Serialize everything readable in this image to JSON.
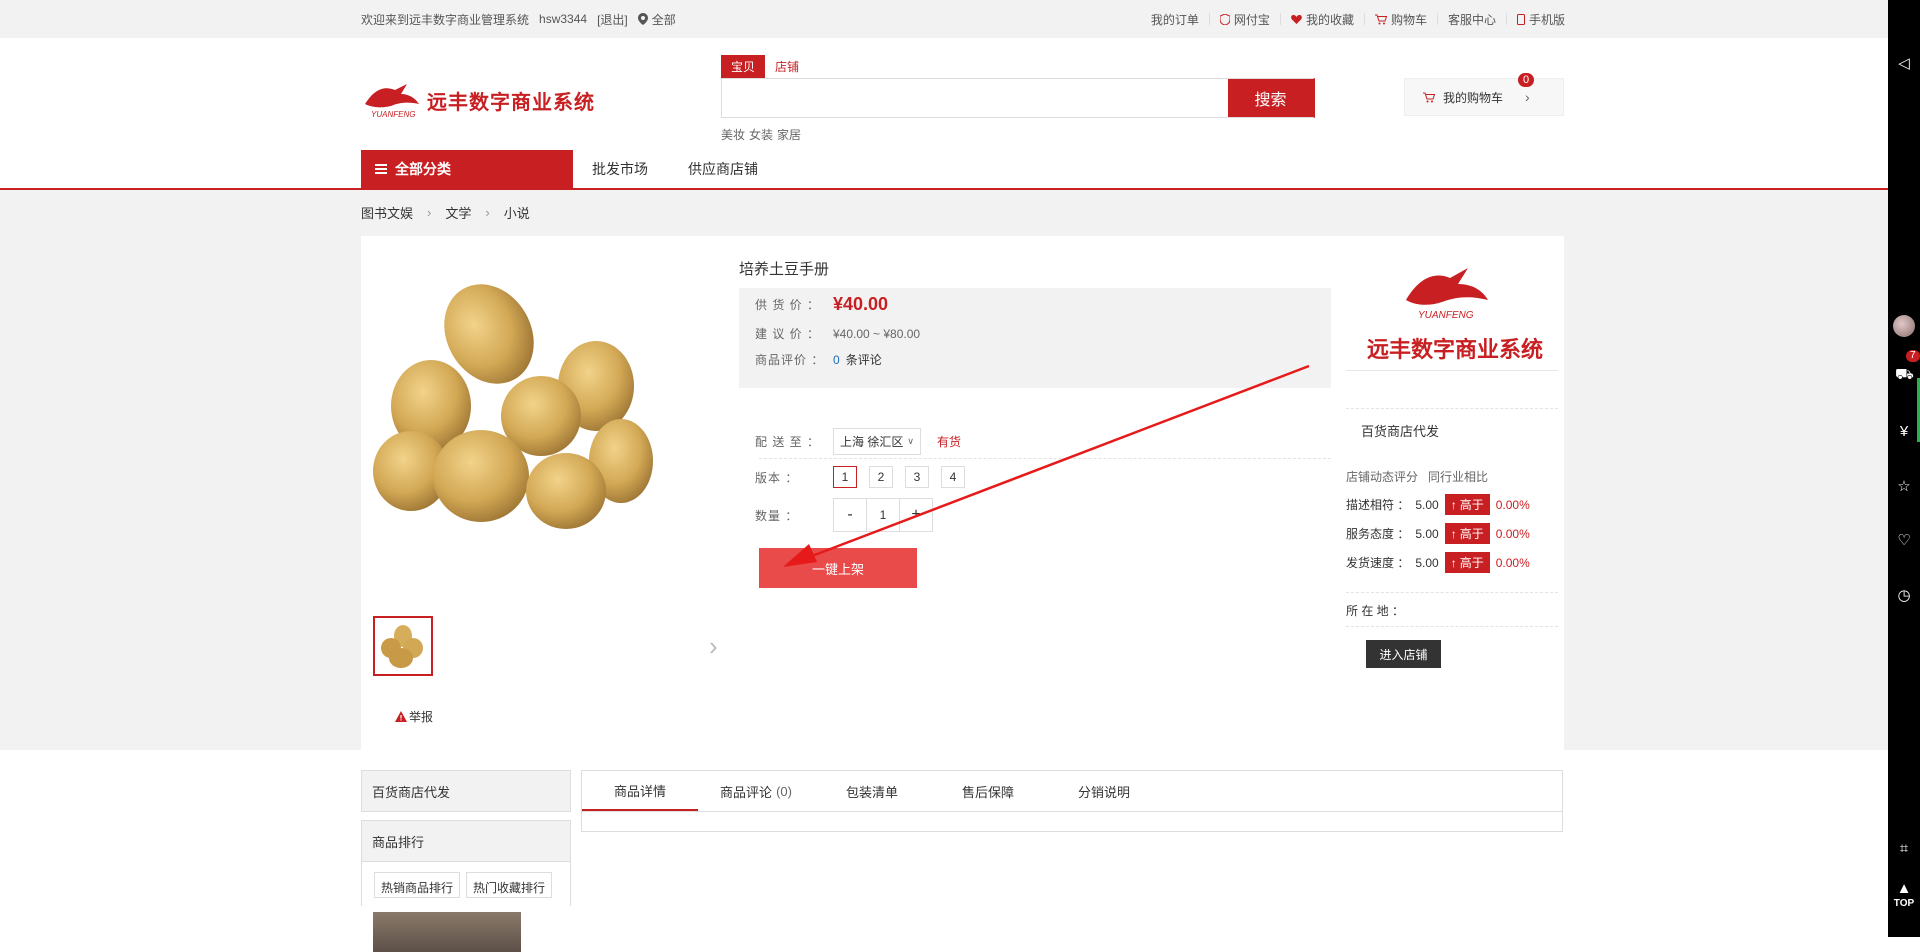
{
  "topbar": {
    "welcome": "欢迎来到远丰数字商业管理系统",
    "username": "hsw3344",
    "logout": "[退出]",
    "location": "全部",
    "links": [
      "我的订单",
      "网付宝",
      "我的收藏",
      "购物车",
      "客服中心",
      "手机版"
    ]
  },
  "header": {
    "brand": "远丰数字商业系统",
    "logo_text": "YUANFENG",
    "search_tabs": [
      "宝贝",
      "店铺"
    ],
    "search_placeholder": "",
    "search_button": "搜索",
    "hotwords": [
      "美妆",
      "女装",
      "家居"
    ],
    "cart_label": "我的购物车",
    "cart_count": "0"
  },
  "nav": {
    "all_categories": "全部分类",
    "links": [
      "批发市场",
      "供应商店铺"
    ]
  },
  "breadcrumb": [
    "图书文娱",
    "文学",
    "小说"
  ],
  "product": {
    "title": "培养土豆手册",
    "supply_price_label": "供 货 价 ：",
    "supply_price": "¥40.00",
    "suggested_price_label": "建 议 价 ：",
    "suggested_price": "¥40.00 ~ ¥80.00",
    "rating_label": "商品评价 ：",
    "rating_count": "0",
    "rating_suffix": "条评论",
    "delivery_label": "配 送 至 ：",
    "delivery_region": "上海 徐汇区",
    "stock": "有货",
    "version_label": "版本 ：",
    "versions": [
      "1",
      "2",
      "3",
      "4"
    ],
    "selected_version": "1",
    "quantity_label": "数量 ：",
    "quantity": "1",
    "minus": "-",
    "plus": "+",
    "one_key_button": "一键上架",
    "report": "举报"
  },
  "store": {
    "logo_text": "YUANFENG",
    "brand": "远丰数字商业系统",
    "name": "百货商店代发",
    "dyn_score": "店铺动态评分",
    "compare": "同行业相比",
    "scores": [
      {
        "label": "描述相符 ：",
        "value": "5.00",
        "badge": "高于",
        "pct": "0.00%"
      },
      {
        "label": "服务态度 ：",
        "value": "5.00",
        "badge": "高于",
        "pct": "0.00%"
      },
      {
        "label": "发货速度 ：",
        "value": "5.00",
        "badge": "高于",
        "pct": "0.00%"
      }
    ],
    "location_label": "所 在 地 ：",
    "enter_button": "进入店铺"
  },
  "lower": {
    "left_store": "百货商店代发",
    "ranking_title": "商品排行",
    "ranking_tabs": [
      "热销商品排行",
      "热门收藏排行"
    ],
    "tabs": [
      {
        "label": "商品详情",
        "count": ""
      },
      {
        "label": "商品评论",
        "count": "(0)"
      },
      {
        "label": "包装清单",
        "count": ""
      },
      {
        "label": "售后保障",
        "count": ""
      },
      {
        "label": "分销说明",
        "count": ""
      }
    ]
  },
  "right_toolbar": {
    "cart_badge": "7",
    "top": "TOP"
  },
  "colors": {
    "brand_red": "#c81f22",
    "button_red": "#e94b4b",
    "link_blue": "#1e6bb8"
  }
}
